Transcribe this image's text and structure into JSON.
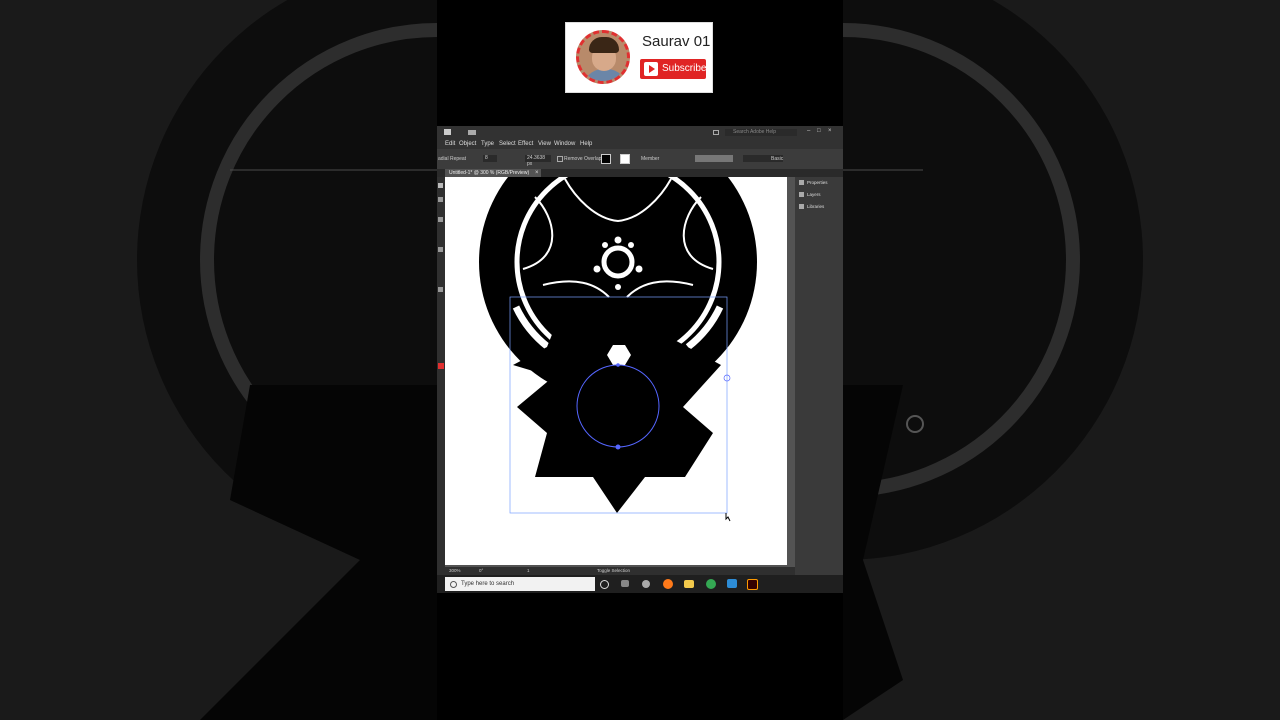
{
  "channel": {
    "name": "Saurav 01",
    "subscribe_label": "Subscribe"
  },
  "app": {
    "search_placeholder": "Search Adobe Help",
    "menu": [
      "Edit",
      "Object",
      "Type",
      "Select",
      "Effect",
      "View",
      "Window",
      "Help"
    ],
    "options": {
      "tool_label": "adial Repeat",
      "instances": "8",
      "radius": "24.3638 px",
      "overlap_label": "Remove Overlap",
      "stroke_style": "Basic",
      "stroke_profile": "Member"
    },
    "document_tab": "Untitled-1* @ 300 % (RGB/Preview)",
    "panel_tabs": [
      "Properties",
      "Layers",
      "Libraries"
    ],
    "status": {
      "zoom": "300%",
      "angle": "0°",
      "artboard_num": "1",
      "tool_hint": "Toggle Selection"
    }
  },
  "taskbar": {
    "search_placeholder": "Type here to search",
    "apps": [
      "cortana-icon",
      "task-view-icon",
      "settings-icon",
      "firefox-icon",
      "file-explorer-icon",
      "chrome-icon",
      "photos-icon",
      "illustrator-icon"
    ]
  },
  "colors": {
    "accent": "#e02424",
    "ui_dark": "#323232",
    "canvas": "#535353"
  }
}
